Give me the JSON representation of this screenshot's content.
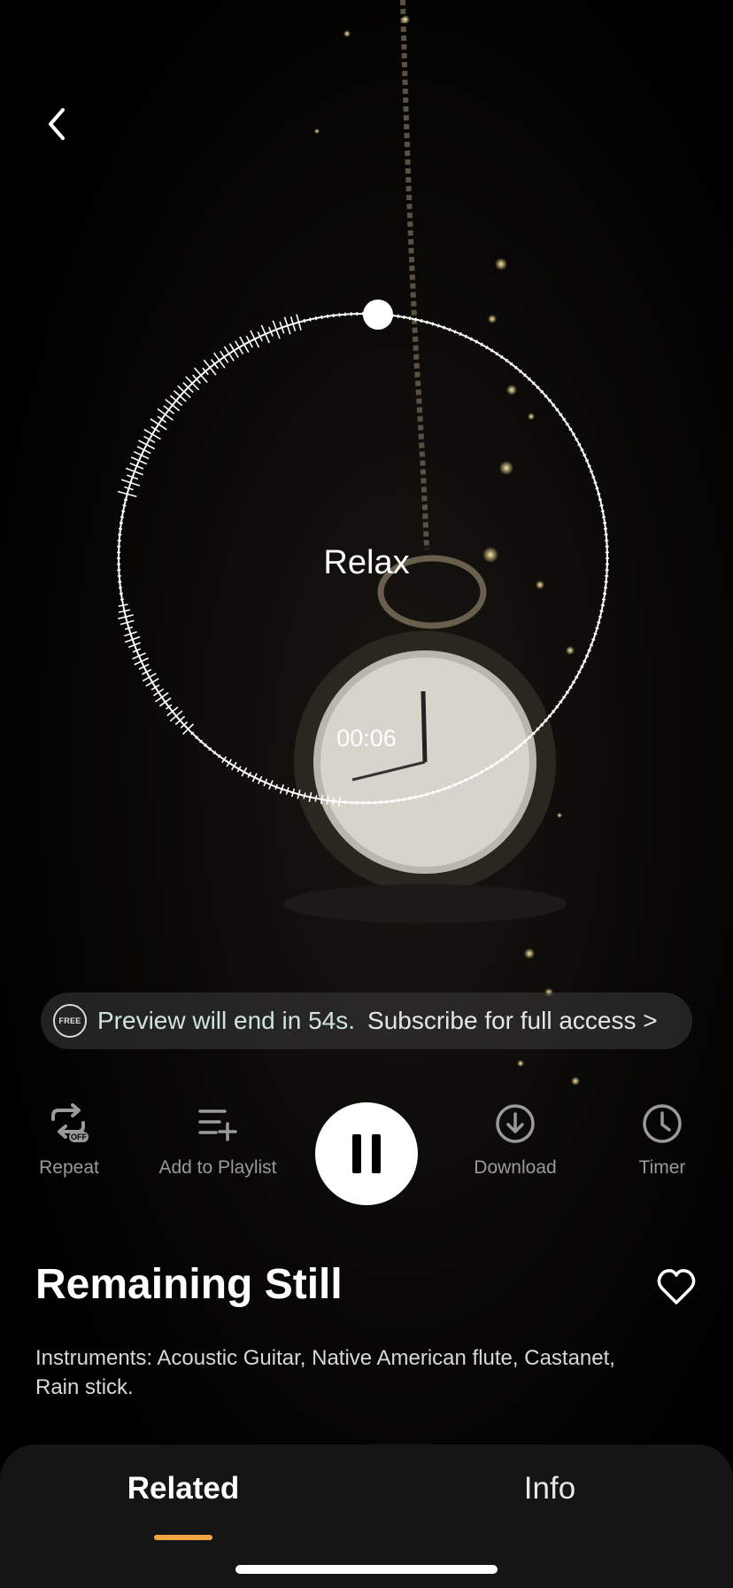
{
  "player": {
    "mood": "Relax",
    "elapsed": "00:06",
    "progress_fraction": 0.01
  },
  "banner": {
    "badge": "FREE",
    "preview_text": "Preview will end in 54s.",
    "subscribe_text": "Subscribe for full access >"
  },
  "controls": {
    "repeat": {
      "label": "Repeat",
      "badge": "OFF"
    },
    "add_to_playlist": {
      "label": "Add to Playlist"
    },
    "download": {
      "label": "Download"
    },
    "timer": {
      "label": "Timer"
    }
  },
  "track": {
    "title": "Remaining Still",
    "description": "Instruments: Acoustic Guitar, Native American flute, Castanet, Rain stick."
  },
  "tabs": {
    "related": "Related",
    "info": "Info"
  },
  "colors": {
    "accent": "#f0a544",
    "banner_text": "#cfe6d8",
    "label_gray": "#9a9a9a"
  },
  "icons": [
    "back-chevron-icon",
    "free-badge-icon",
    "repeat-icon",
    "add-to-playlist-icon",
    "pause-icon",
    "download-icon",
    "timer-icon",
    "heart-icon"
  ]
}
